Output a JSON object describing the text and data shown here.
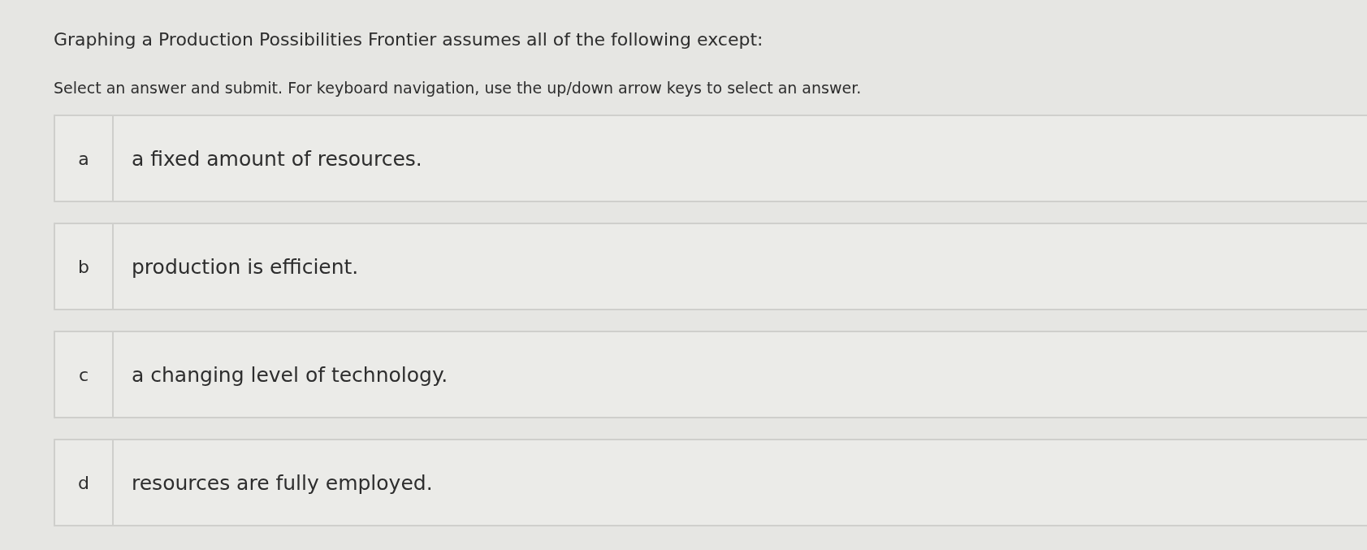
{
  "question": "Graphing a Production Possibilities Frontier assumes all of the following except:",
  "instructions": "Select an answer and submit. For keyboard navigation, use the up/down arrow keys to select an answer.",
  "options": [
    {
      "letter": "a",
      "text": "a fixed amount of resources."
    },
    {
      "letter": "b",
      "text": "production is efficient."
    },
    {
      "letter": "c",
      "text": "a changing level of technology."
    },
    {
      "letter": "d",
      "text": "resources are fully employed."
    }
  ]
}
